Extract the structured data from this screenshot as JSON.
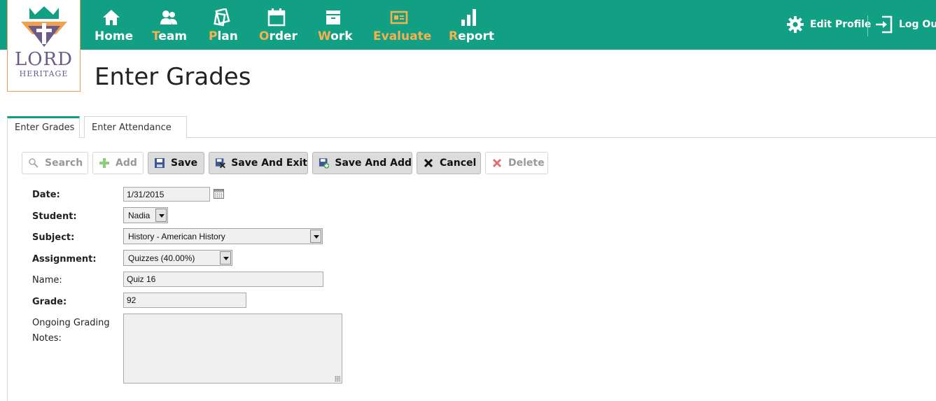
{
  "brand": {
    "logo_line1": "LORD",
    "logo_line2": "HERITAGE"
  },
  "nav": [
    {
      "label": "Home",
      "first": "",
      "rest": "Home",
      "icon": "home-icon"
    },
    {
      "label": "Team",
      "first": "T",
      "rest": "eam",
      "icon": "team-icon"
    },
    {
      "label": "Plan",
      "first": "P",
      "rest": "lan",
      "icon": "plan-icon"
    },
    {
      "label": "Order",
      "first": "O",
      "rest": "rder",
      "icon": "calendar-icon"
    },
    {
      "label": "Work",
      "first": "W",
      "rest": "ork",
      "icon": "work-icon"
    },
    {
      "label": "Evaluate",
      "first": "",
      "rest": "Evaluate",
      "icon": "evaluate-icon"
    },
    {
      "label": "Report",
      "first": "R",
      "rest": "eport",
      "icon": "bar-chart-icon"
    }
  ],
  "account": {
    "edit_profile": "Edit Profile",
    "log_out": "Log Out"
  },
  "page": {
    "title": "Enter Grades"
  },
  "tabs": [
    {
      "label": "Enter Grades"
    },
    {
      "label": "Enter Attendance"
    }
  ],
  "toolbar": {
    "search": "Search",
    "add": "Add",
    "save": "Save",
    "save_exit": "Save And Exit",
    "save_add": "Save And Add",
    "cancel": "Cancel",
    "delete": "Delete"
  },
  "form": {
    "date_label": "Date:",
    "date_value": "1/31/2015",
    "student_label": "Student:",
    "student_value": "Nadia",
    "subject_label": "Subject:",
    "subject_value": "History - American History",
    "assignment_label": "Assignment:",
    "assignment_value": "Quizzes (40.00%)",
    "name_label": "Name:",
    "name_value": "Quiz 16",
    "grade_label": "Grade:",
    "grade_value": "92",
    "notes_label_line1": "Ongoing Grading",
    "notes_label_line2": "Notes:",
    "notes_value": ""
  },
  "colors": {
    "topbar": "#12a085",
    "accent": "#f6b04d",
    "logo_purple": "#6b5a8a"
  }
}
